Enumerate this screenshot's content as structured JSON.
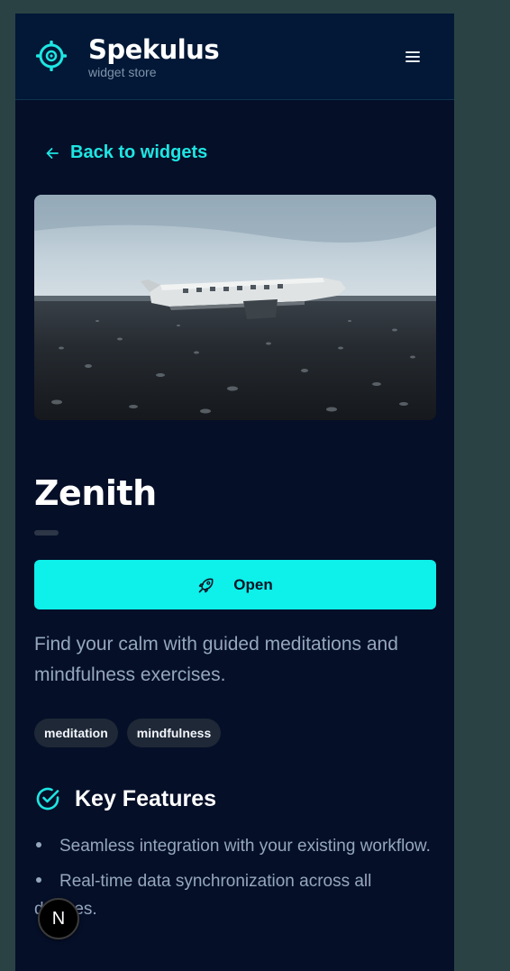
{
  "brand": {
    "name": "Spekulus",
    "subtitle": "widget store",
    "logo_icon": "crosshair-gear-icon",
    "accent_color": "#1ee6e3"
  },
  "header": {
    "menu_icon": "hamburger-menu-icon"
  },
  "nav": {
    "back_label": "Back to widgets",
    "back_icon": "arrow-left-icon"
  },
  "widget": {
    "hero_image": "crashed-plane-on-black-beach-photo",
    "title": "Zenith",
    "open_label": "Open",
    "open_icon": "rocket-icon",
    "open_color": "#0ef0ea",
    "description": "Find your calm with guided meditations and mindfulness exercises.",
    "tags": [
      "meditation",
      "mindfulness"
    ]
  },
  "features": {
    "heading": "Key Features",
    "heading_icon": "check-circle-icon",
    "items": [
      "Seamless integration with your existing workflow.",
      "Real-time data synchronization across all devices."
    ]
  },
  "dev_badge": {
    "label": "N"
  }
}
